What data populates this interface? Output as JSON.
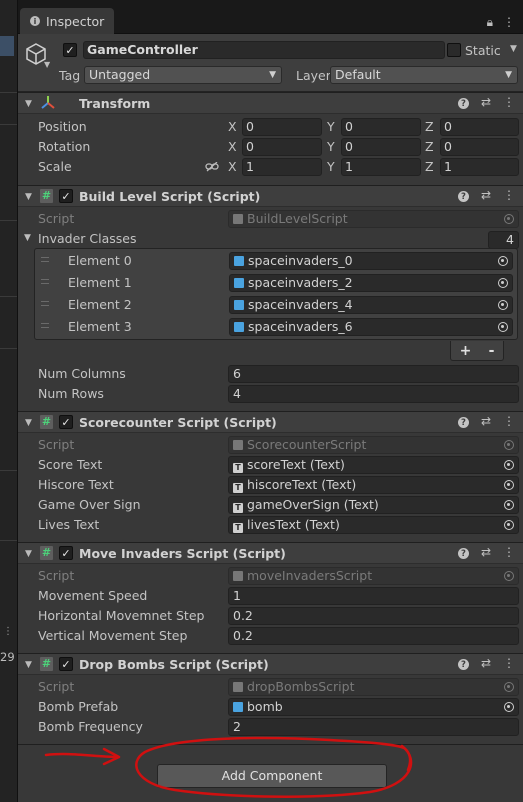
{
  "tab": {
    "title": "Inspector"
  },
  "left": {
    "number": "29"
  },
  "header": {
    "name": "GameController",
    "static_label": "Static",
    "tag_label": "Tag",
    "tag_value": "Untagged",
    "layer_label": "Layer",
    "layer_value": "Default"
  },
  "transform": {
    "title": "Transform",
    "rows": [
      {
        "label": "Position",
        "x": "0",
        "y": "0",
        "z": "0"
      },
      {
        "label": "Rotation",
        "x": "0",
        "y": "0",
        "z": "0"
      },
      {
        "label": "Scale",
        "x": "1",
        "y": "1",
        "z": "1"
      }
    ],
    "axis": {
      "x": "X",
      "y": "Y",
      "z": "Z"
    }
  },
  "build_level": {
    "title": "Build Level Script (Script)",
    "script_label": "Script",
    "script_value": "BuildLevelScript",
    "list_label": "Invader Classes",
    "list_count": "4",
    "elements": [
      {
        "label": "Element 0",
        "value": "spaceinvaders_0"
      },
      {
        "label": "Element 1",
        "value": "spaceinvaders_2"
      },
      {
        "label": "Element 2",
        "value": "spaceinvaders_4"
      },
      {
        "label": "Element 3",
        "value": "spaceinvaders_6"
      }
    ],
    "plus": "+",
    "minus": "-",
    "num_columns_label": "Num Columns",
    "num_columns_value": "6",
    "num_rows_label": "Num Rows",
    "num_rows_value": "4"
  },
  "scorecounter": {
    "title": "Scorecounter Script (Script)",
    "script_label": "Script",
    "script_value": "ScorecounterScript",
    "rows": [
      {
        "label": "Score Text",
        "value": "scoreText (Text)"
      },
      {
        "label": "Hiscore Text",
        "value": "hiscoreText (Text)"
      },
      {
        "label": "Game Over Sign",
        "value": "gameOverSign (Text)"
      },
      {
        "label": "Lives Text",
        "value": "livesText (Text)"
      }
    ]
  },
  "move_invaders": {
    "title": "Move Invaders Script (Script)",
    "script_label": "Script",
    "script_value": "moveInvadersScript",
    "rows": [
      {
        "label": "Movement Speed",
        "value": "1"
      },
      {
        "label": "Horizontal Movemnet Step",
        "value": "0.2"
      },
      {
        "label": "Vertical Movement Step",
        "value": "0.2"
      }
    ]
  },
  "drop_bombs": {
    "title": "Drop Bombs Script (Script)",
    "script_label": "Script",
    "script_value": "dropBombsScript",
    "bomb_prefab_label": "Bomb Prefab",
    "bomb_prefab_value": "bomb",
    "bomb_frequency_label": "Bomb Frequency",
    "bomb_frequency_value": "2"
  },
  "add_component": {
    "label": "Add Component"
  },
  "colors": {
    "panel_bg": "#383838",
    "header_bg": "#3e3e3e",
    "field_bg": "#2a2a2a",
    "script_icon": "#4dd27a",
    "prefab_icon": "#4aa3e0",
    "annotation_red": "#d01010"
  }
}
